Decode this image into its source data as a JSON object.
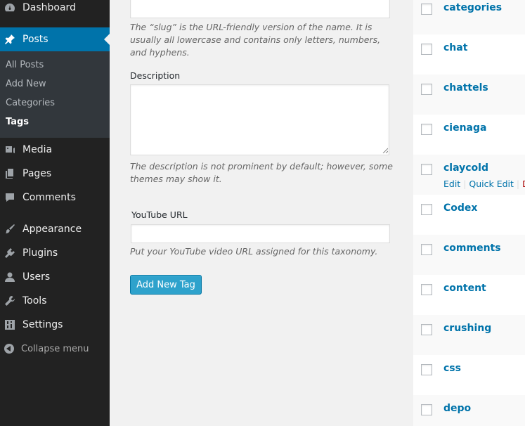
{
  "sidebar": {
    "dashboard": "Dashboard",
    "posts": "Posts",
    "submenu": {
      "all_posts": "All Posts",
      "add_new": "Add New",
      "categories": "Categories",
      "tags": "Tags"
    },
    "media": "Media",
    "pages": "Pages",
    "comments": "Comments",
    "appearance": "Appearance",
    "plugins": "Plugins",
    "users": "Users",
    "tools": "Tools",
    "settings": "Settings",
    "collapse": "Collapse menu"
  },
  "form": {
    "slug_value": "",
    "slug_help": "The “slug” is the URL-friendly version of the name. It is usually all lowercase and contains only letters, numbers, and hyphens.",
    "description_label": "Description",
    "description_value": "",
    "description_help": "The description is not prominent by default; however, some themes may show it.",
    "youtube_label": "YouTube URL",
    "youtube_value": "",
    "youtube_help": "Put your YouTube video URL assigned for this taxonomy.",
    "submit_label": "Add New Tag"
  },
  "tags": [
    {
      "name": "categories"
    },
    {
      "name": "chat"
    },
    {
      "name": "chattels"
    },
    {
      "name": "cienaga"
    },
    {
      "name": "claycold",
      "actions": {
        "edit": "Edit",
        "quick_edit": "Quick Edit",
        "delete": "D"
      }
    },
    {
      "name": "Codex"
    },
    {
      "name": "comments"
    },
    {
      "name": "content"
    },
    {
      "name": "crushing"
    },
    {
      "name": "css"
    },
    {
      "name": "depo"
    }
  ]
}
